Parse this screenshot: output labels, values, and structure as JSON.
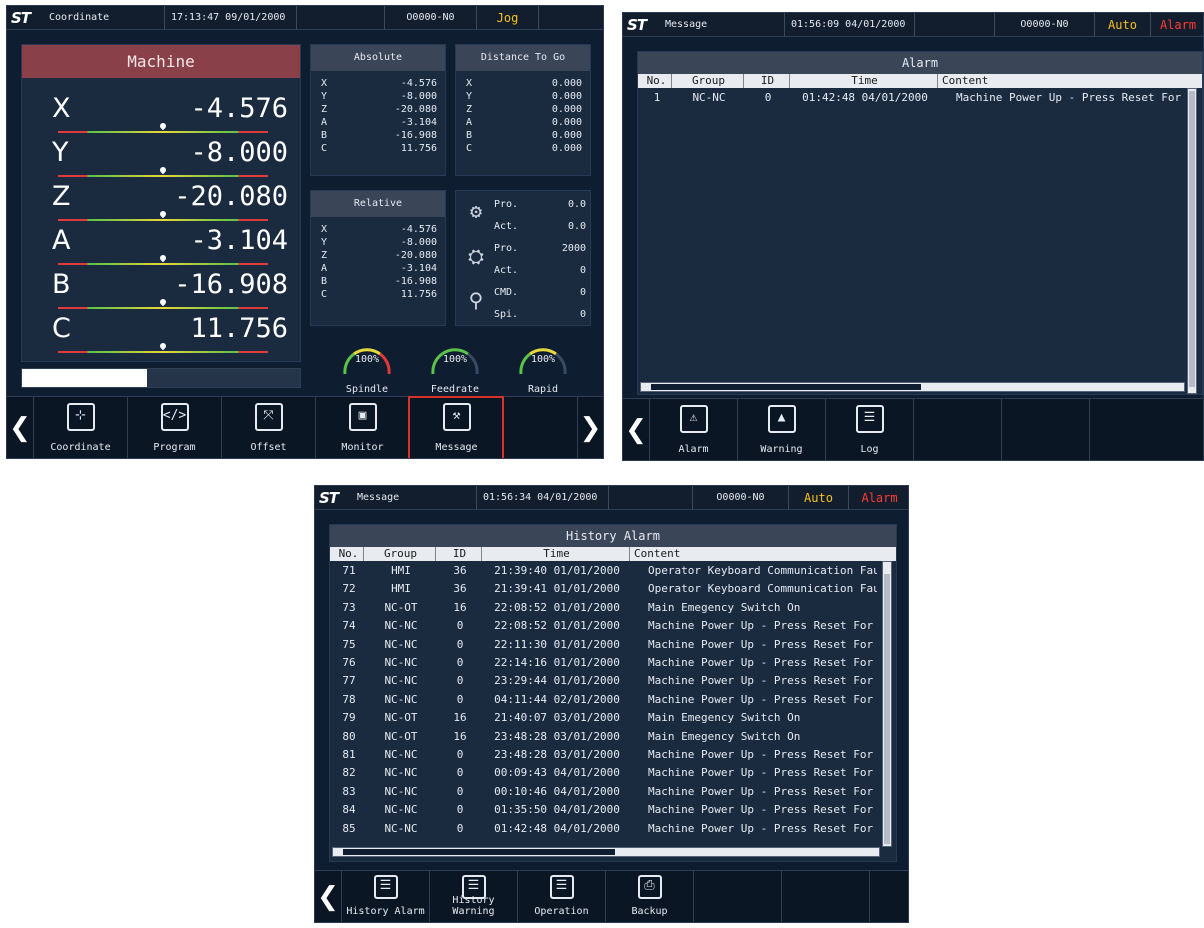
{
  "coord": {
    "logo": "ST",
    "page": "Coordinate",
    "datetime": "17:13:47 09/01/2000",
    "program": "O0000-N0",
    "mode": "Jog",
    "machine_title": "Machine",
    "axes": [
      {
        "axis": "X",
        "value": "-4.576"
      },
      {
        "axis": "Y",
        "value": "-8.000"
      },
      {
        "axis": "Z",
        "value": "-20.080"
      },
      {
        "axis": "A",
        "value": "-3.104"
      },
      {
        "axis": "B",
        "value": "-16.908"
      },
      {
        "axis": "C",
        "value": "11.756"
      }
    ],
    "progress": 0.45,
    "absolute": {
      "title": "Absolute",
      "rows": [
        [
          "X",
          "-4.576"
        ],
        [
          "Y",
          "-8.000"
        ],
        [
          "Z",
          "-20.080"
        ],
        [
          "A",
          "-3.104"
        ],
        [
          "B",
          "-16.908"
        ],
        [
          "C",
          "11.756"
        ]
      ]
    },
    "distance": {
      "title": "Distance To Go",
      "rows": [
        [
          "X",
          "0.000"
        ],
        [
          "Y",
          "0.000"
        ],
        [
          "Z",
          "0.000"
        ],
        [
          "A",
          "0.000"
        ],
        [
          "B",
          "0.000"
        ],
        [
          "C",
          "0.000"
        ]
      ]
    },
    "relative": {
      "title": "Relative",
      "rows": [
        [
          "X",
          "-4.576"
        ],
        [
          "Y",
          "-8.000"
        ],
        [
          "Z",
          "-20.080"
        ],
        [
          "A",
          "-3.104"
        ],
        [
          "B",
          "-16.908"
        ],
        [
          "C",
          "11.756"
        ]
      ]
    },
    "info": [
      [
        "Pro.",
        "0.0"
      ],
      [
        "Act.",
        "0.0"
      ],
      [
        "Pro.",
        "2000"
      ],
      [
        "Act.",
        "0"
      ],
      [
        "CMD.",
        "0"
      ],
      [
        "Spi.",
        "0"
      ]
    ],
    "gauges": [
      {
        "label": "Spindle",
        "value": "100%"
      },
      {
        "label": "Feedrate",
        "value": "100%"
      },
      {
        "label": "Rapid",
        "value": "100%"
      }
    ],
    "toolbar": [
      "Coordinate",
      "Program",
      "Offset",
      "Monitor",
      "Message"
    ]
  },
  "alarm": {
    "logo": "ST",
    "page": "Message",
    "datetime": "01:56:09 04/01/2000",
    "program": "O0000-N0",
    "mode": "Auto",
    "status": "Alarm",
    "title": "Alarm",
    "columns": [
      "No.",
      "Group",
      "ID",
      "Time",
      "Content"
    ],
    "rows": [
      [
        "1",
        "NC-NC",
        "0",
        "01:42:48  04/01/2000",
        "Machine Power Up - Press Reset For"
      ]
    ],
    "toolbar": [
      "Alarm",
      "Warning",
      "Log"
    ]
  },
  "history": {
    "logo": "ST",
    "page": "Message",
    "datetime": "01:56:34 04/01/2000",
    "program": "O0000-N0",
    "mode": "Auto",
    "status": "Alarm",
    "title": "History Alarm",
    "columns": [
      "No.",
      "Group",
      "ID",
      "Time",
      "Content"
    ],
    "rows": [
      [
        "71",
        "HMI",
        "36",
        "21:39:40  01/01/2000",
        "Operator Keyboard Communication Fau"
      ],
      [
        "72",
        "HMI",
        "36",
        "21:39:41  01/01/2000",
        "Operator Keyboard Communication Fau"
      ],
      [
        "73",
        "NC-OT",
        "16",
        "22:08:52  01/01/2000",
        "Main Emegency Switch On"
      ],
      [
        "74",
        "NC-NC",
        "0",
        "22:08:52  01/01/2000",
        "Machine Power Up - Press Reset For"
      ],
      [
        "75",
        "NC-NC",
        "0",
        "22:11:30  01/01/2000",
        "Machine Power Up - Press Reset For"
      ],
      [
        "76",
        "NC-NC",
        "0",
        "22:14:16  01/01/2000",
        "Machine Power Up - Press Reset For"
      ],
      [
        "77",
        "NC-NC",
        "0",
        "23:29:44  01/01/2000",
        "Machine Power Up - Press Reset For"
      ],
      [
        "78",
        "NC-NC",
        "0",
        "04:11:44  02/01/2000",
        "Machine Power Up - Press Reset For"
      ],
      [
        "79",
        "NC-OT",
        "16",
        "21:40:07  03/01/2000",
        "Main Emegency Switch On"
      ],
      [
        "80",
        "NC-OT",
        "16",
        "23:48:28  03/01/2000",
        "Main Emegency Switch On"
      ],
      [
        "81",
        "NC-NC",
        "0",
        "23:48:28  03/01/2000",
        "Machine Power Up - Press Reset For"
      ],
      [
        "82",
        "NC-NC",
        "0",
        "00:09:43  04/01/2000",
        "Machine Power Up - Press Reset For"
      ],
      [
        "83",
        "NC-NC",
        "0",
        "00:10:46  04/01/2000",
        "Machine Power Up - Press Reset For"
      ],
      [
        "84",
        "NC-NC",
        "0",
        "01:35:50  04/01/2000",
        "Machine Power Up - Press Reset For"
      ],
      [
        "85",
        "NC-NC",
        "0",
        "01:42:48  04/01/2000",
        "Machine Power Up - Press Reset For"
      ]
    ],
    "toolbar": [
      "History Alarm",
      "History Warning",
      "Operation",
      "Backup"
    ]
  }
}
